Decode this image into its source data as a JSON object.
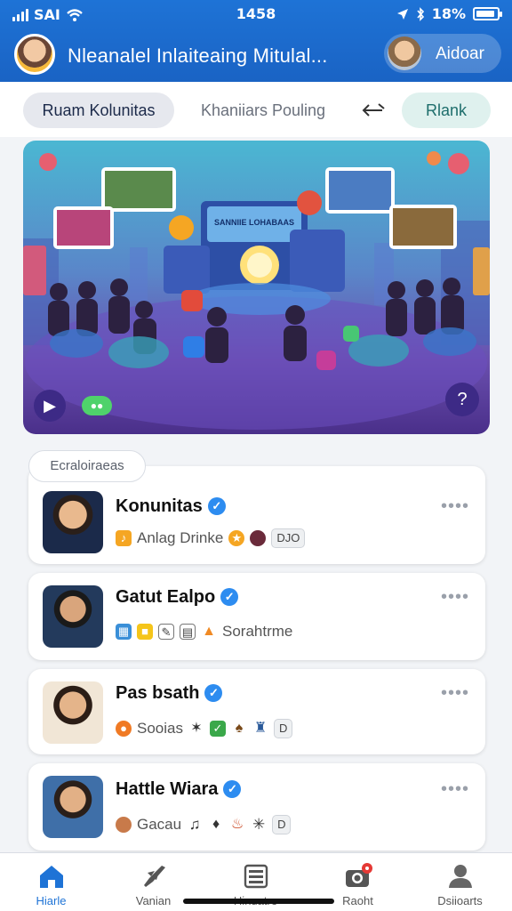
{
  "status_bar": {
    "carrier": "SAI",
    "time": "1458",
    "battery": "18%"
  },
  "header": {
    "title": "Nleanalel Inlaiteaing Mitulal...",
    "action_label": "Aidoar"
  },
  "tabs": [
    {
      "label": "Ruam Kolunitas"
    },
    {
      "label": "Khaniiars Pouling"
    },
    {
      "label": "Rlank"
    }
  ],
  "banner": {
    "screen_text": "SANNIIE LOHABAAS",
    "pill_label": "●●",
    "help_label": "?"
  },
  "section_label": "Ecraloiraeas",
  "communities": [
    {
      "name": "Konunitas",
      "more": "••••",
      "meta_text": "Anlag Drinke",
      "tag": "DJO"
    },
    {
      "name": "Gatut Ealpo",
      "more": "••••",
      "meta_text": "Sorahtrme",
      "tag": ""
    },
    {
      "name": "Pas bsath",
      "more": "••••",
      "meta_text": "Sooias",
      "tag": "D"
    },
    {
      "name": "Hattle Wiara",
      "more": "••••",
      "meta_text": "Gacau",
      "tag": "D"
    }
  ],
  "bottom_nav": [
    {
      "label": "Hiarle",
      "icon": "home-icon"
    },
    {
      "label": "Vanian",
      "icon": "rocket-icon"
    },
    {
      "label": "Hinuatre",
      "icon": "list-icon"
    },
    {
      "label": "Raoht",
      "icon": "camera-icon"
    },
    {
      "label": "Dsiioarts",
      "icon": "person-icon"
    }
  ],
  "colors": {
    "brand": "#1e73d6",
    "verified": "#2d8cf0",
    "join": "#dff1ee"
  }
}
